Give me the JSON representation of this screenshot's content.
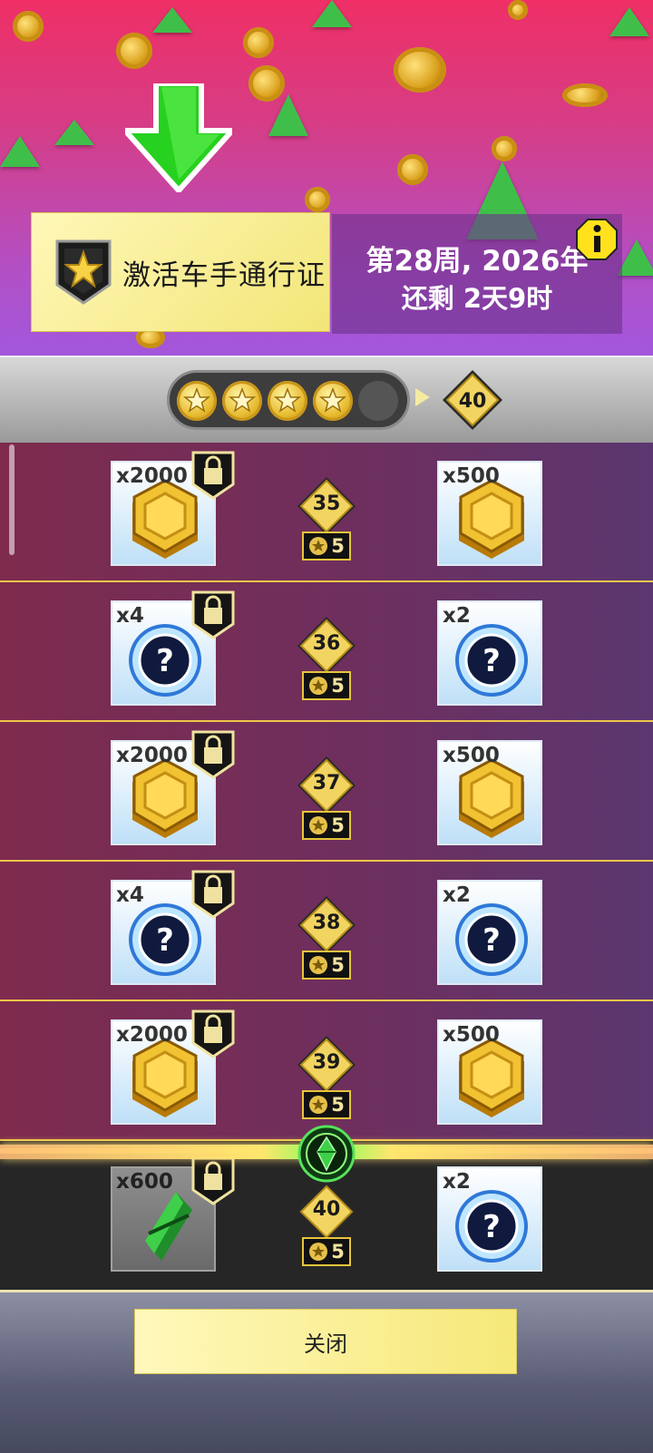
{
  "header": {
    "activate_label": "激活车手通行证",
    "week_line1": "第28周, 2026年",
    "week_line2": "还剩 2天9时"
  },
  "progress": {
    "stars_earned": 4,
    "stars_total": 5,
    "goal_level": "40"
  },
  "rows": [
    {
      "level": "35",
      "cost": "5",
      "left": {
        "qty": "x2000",
        "type": "coin",
        "locked": true
      },
      "right": {
        "qty": "x500",
        "type": "coin"
      }
    },
    {
      "level": "36",
      "cost": "5",
      "left": {
        "qty": "x4",
        "type": "mystery",
        "locked": true
      },
      "right": {
        "qty": "x2",
        "type": "mystery"
      }
    },
    {
      "level": "37",
      "cost": "5",
      "left": {
        "qty": "x2000",
        "type": "coin",
        "locked": true
      },
      "right": {
        "qty": "x500",
        "type": "coin"
      }
    },
    {
      "level": "38",
      "cost": "5",
      "left": {
        "qty": "x4",
        "type": "mystery",
        "locked": true
      },
      "right": {
        "qty": "x2",
        "type": "mystery"
      }
    },
    {
      "level": "39",
      "cost": "5",
      "left": {
        "qty": "x2000",
        "type": "coin",
        "locked": true
      },
      "right": {
        "qty": "x500",
        "type": "coin"
      }
    },
    {
      "level": "40",
      "cost": "5",
      "left": {
        "qty": "x600",
        "type": "gem",
        "locked": true
      },
      "right": {
        "qty": "x2",
        "type": "mystery"
      }
    }
  ],
  "footer": {
    "close_label": "关闭"
  },
  "colors": {
    "accent_yellow": "#f6e879",
    "row_bg": "#6e2f5e",
    "gold": "#e6b92c"
  }
}
